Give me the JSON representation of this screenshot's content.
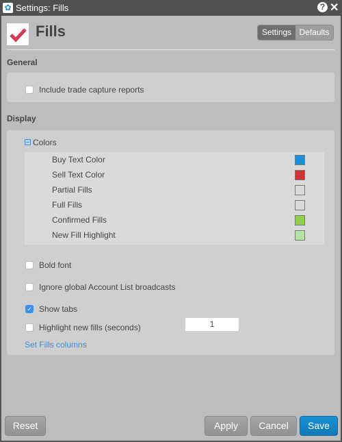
{
  "window": {
    "title": "Settings: Fills"
  },
  "header": {
    "title": "Fills",
    "toggle": [
      "Settings",
      "Defaults"
    ]
  },
  "general": {
    "heading": "General",
    "include_trade_capture": {
      "label": "Include trade capture reports",
      "checked": false
    }
  },
  "display": {
    "heading": "Display",
    "colors_label": "Colors",
    "colors": [
      {
        "label": "Buy Text Color",
        "color": "#1a8fd6"
      },
      {
        "label": "Sell Text Color",
        "color": "#d23434"
      },
      {
        "label": "Partial Fills",
        "color": "#dadada"
      },
      {
        "label": "Full Fills",
        "color": "#dadada"
      },
      {
        "label": "Confirmed Fills",
        "color": "#8fd14f"
      },
      {
        "label": "New Fill Highlight",
        "color": "#b7e2a6"
      }
    ],
    "bold_font": {
      "label": "Bold font",
      "checked": false
    },
    "ignore_broadcasts": {
      "label": "Ignore global Account List broadcasts",
      "checked": false
    },
    "show_tabs": {
      "label": "Show tabs",
      "checked": true
    },
    "highlight_new": {
      "label": "Highlight new fills (seconds)",
      "checked": false,
      "value": "1"
    },
    "set_columns": "Set Fills columns"
  },
  "footer": {
    "reset": "Reset",
    "apply": "Apply",
    "cancel": "Cancel",
    "save": "Save"
  }
}
